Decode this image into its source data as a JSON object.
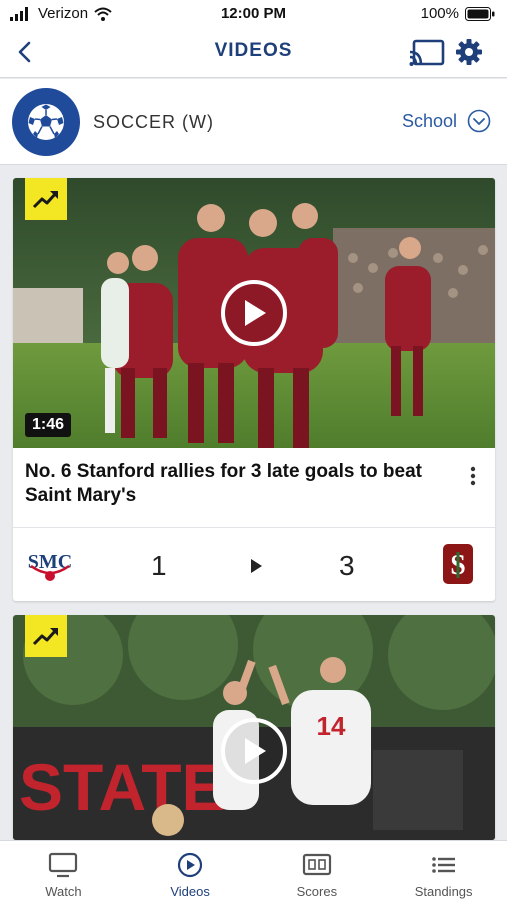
{
  "status": {
    "carrier": "Verizon",
    "time": "12:00 PM",
    "battery": "100%"
  },
  "nav": {
    "title": "VIDEOS",
    "back_icon": "chevron-left-icon",
    "cast_icon": "cast-icon",
    "settings_icon": "gear-icon"
  },
  "sport": {
    "name": "SOCCER (W)",
    "icon": "soccer-ball-icon",
    "school_label": "School"
  },
  "videos": [
    {
      "trending_icon": "trending-up-icon",
      "duration": "1:46",
      "title": "No. 6 Stanford rallies for 3 late goals to beat Saint Mary's",
      "away_score": "1",
      "home_score": "3",
      "away_team_logo": "SMC",
      "home_team_logo": "S"
    },
    {
      "trending_icon": "trending-up-icon",
      "banner_text": "STATE"
    }
  ],
  "tabs": [
    {
      "label": "Watch",
      "icon": "tv-icon"
    },
    {
      "label": "Videos",
      "icon": "play-circle-icon"
    },
    {
      "label": "Scores",
      "icon": "scoreboard-icon"
    },
    {
      "label": "Standings",
      "icon": "list-icon"
    }
  ],
  "colors": {
    "brand_blue": "#1e3f7a",
    "link_blue": "#2b5aa3",
    "trend_yellow": "#f2e722",
    "stanford_red": "#8c1515"
  }
}
